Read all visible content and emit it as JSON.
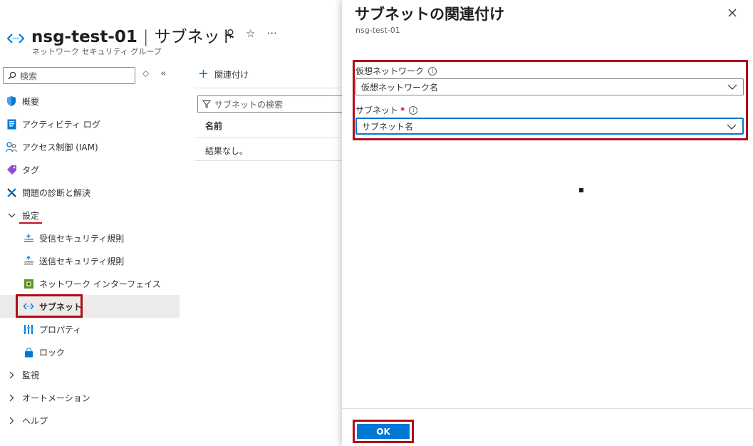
{
  "resource": {
    "name": "nsg-test-01",
    "separator": "|",
    "section": "サブネット",
    "type_label": "ネットワーク セキュリティ グループ",
    "pin_glyph": "⚲",
    "star_glyph": "☆",
    "more_glyph": "···"
  },
  "sidebar": {
    "search_placeholder": "検索",
    "updown_glyph": "⬦",
    "collapse_glyph": "«",
    "items": [
      {
        "label": "概要"
      },
      {
        "label": "アクティビティ ログ"
      },
      {
        "label": "アクセス制御 (IAM)"
      },
      {
        "label": "タグ"
      },
      {
        "label": "問題の診断と解決"
      },
      {
        "label": "設定"
      },
      {
        "label": "受信セキュリティ規則"
      },
      {
        "label": "送信セキュリティ規則"
      },
      {
        "label": "ネットワーク インターフェイス"
      },
      {
        "label": "サブネット"
      },
      {
        "label": "プロパティ"
      },
      {
        "label": "ロック"
      },
      {
        "label": "監視"
      },
      {
        "label": "オートメーション"
      },
      {
        "label": "ヘルプ"
      }
    ]
  },
  "main": {
    "add_label": "関連付け",
    "filter_placeholder": "サブネットの検索",
    "column_name": "名前",
    "empty_text": "結果なし。"
  },
  "panel": {
    "title": "サブネットの関連付け",
    "subtitle": "nsg-test-01",
    "vnet_label": "仮想ネットワーク",
    "vnet_value": "仮想ネットワーク名",
    "subnet_label": "サブネット",
    "required_mark": "*",
    "info_glyph": "i",
    "subnet_value": "サブネット名",
    "ok_label": "OK"
  },
  "colors": {
    "accent": "#0078d4",
    "highlight_border": "#b00c1a",
    "selected_bg": "#edebe9"
  }
}
